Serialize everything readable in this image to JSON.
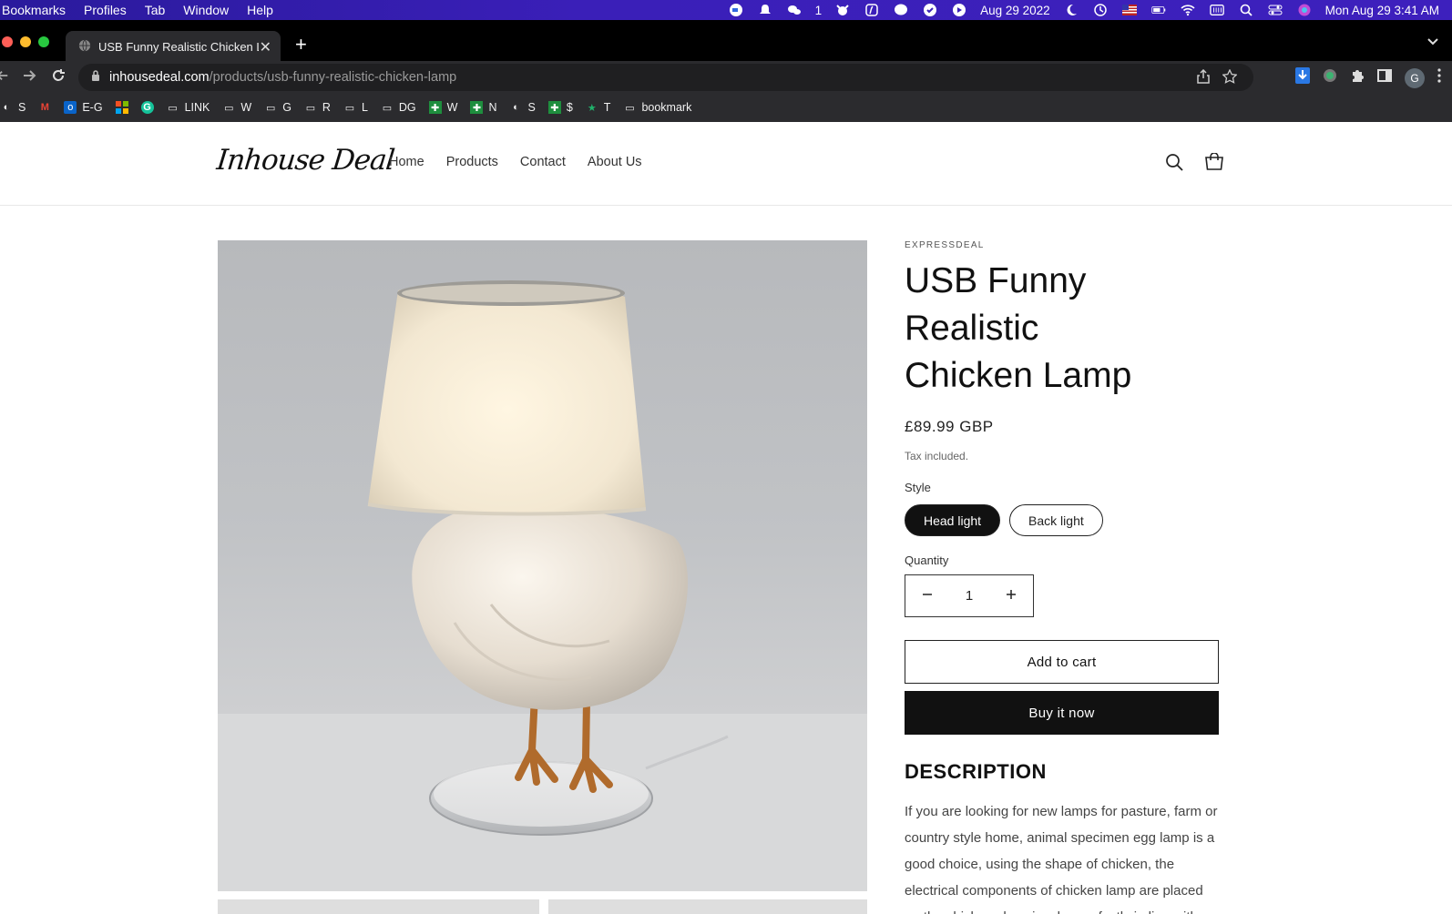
{
  "menubar": {
    "items": [
      "Bookmarks",
      "Profiles",
      "Tab",
      "Window",
      "Help"
    ],
    "wechat_count": "1",
    "date": "Aug 29 2022",
    "clock": "Mon Aug 29  3:41 AM"
  },
  "tab": {
    "title": "USB Funny Realistic Chicken L"
  },
  "omnibox": {
    "domain": "inhousedeal.com",
    "path": "/products/usb-funny-realistic-chicken-lamp"
  },
  "profile_initial": "G",
  "bookmarks": [
    "S",
    "",
    "E-G",
    "",
    "",
    "LINK",
    "W",
    "G",
    "R",
    "L",
    "DG",
    "W",
    "N",
    "S",
    "$",
    "T",
    "bookmark"
  ],
  "store": {
    "logo": "Inhouse Deal",
    "nav": [
      "Home",
      "Products",
      "Contact",
      "About Us"
    ]
  },
  "product": {
    "vendor": "EXPRESSDEAL",
    "title_line1": "USB Funny Realistic",
    "title_line2": "Chicken Lamp",
    "price": "£89.99 GBP",
    "tax_note": "Tax included.",
    "style_label": "Style",
    "styles": [
      "Head light",
      "Back light"
    ],
    "selected_style": "Head light",
    "quantity_label": "Quantity",
    "quantity": "1",
    "add_to_cart": "Add to cart",
    "buy_now": "Buy it now",
    "description_heading": "DESCRIPTION",
    "description": "If you are looking for new lamps for pasture, farm or country style home, animal specimen egg lamp is a good choice, using the shape of chicken, the electrical components of chicken lamp are placed on the chicken chassis, also perfectly in line with the scene."
  },
  "colors": {
    "menubar": "#3a1fb8",
    "chrome": "#2b2b2e",
    "accent": "#111111"
  }
}
